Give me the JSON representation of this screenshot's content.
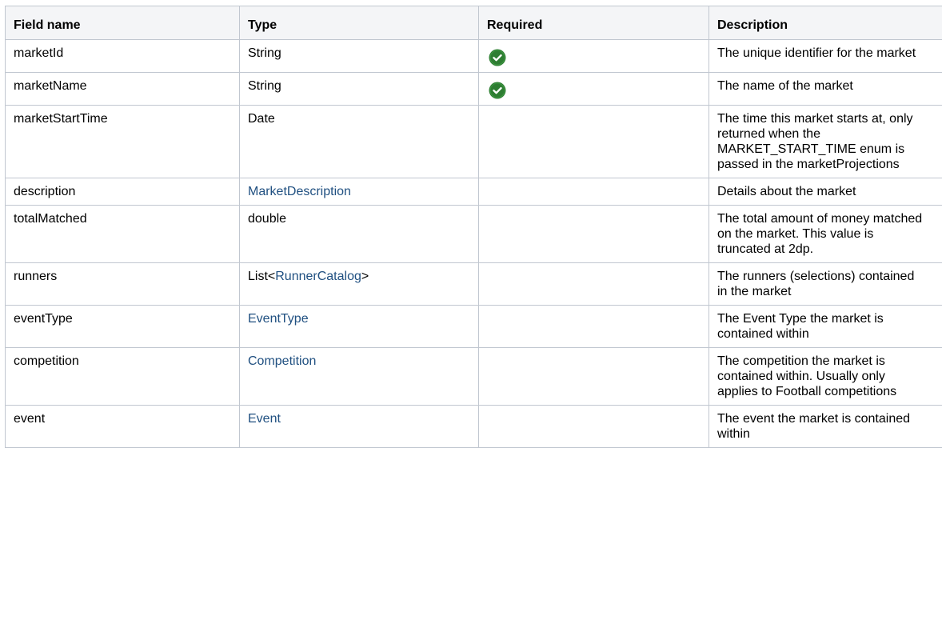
{
  "table": {
    "headers": [
      "Field name",
      "Type",
      "Required",
      "Description"
    ],
    "rows": [
      {
        "field": "marketId",
        "type_text": "String",
        "required": true,
        "description": "The unique identifier for the market"
      },
      {
        "field": "marketName",
        "type_text": "String",
        "required": true,
        "description": "The name of the market"
      },
      {
        "field": "marketStartTime",
        "type_text": "Date",
        "required": false,
        "description": "The time this market starts at, only returned when the MARKET_START_TIME enum is passed in the marketProjections"
      },
      {
        "field": "description",
        "type_link": "MarketDescription",
        "required": false,
        "description": "Details about the market"
      },
      {
        "field": "totalMatched",
        "type_text": "double",
        "required": false,
        "description": "The total amount of money matched on the market. This value is truncated at 2dp."
      },
      {
        "field": "runners",
        "type_prefix": "List<",
        "type_link": "RunnerCatalog",
        "type_suffix": ">",
        "required": false,
        "description": "The runners (selections) contained in the market"
      },
      {
        "field": "eventType",
        "type_link": "EventType",
        "required": false,
        "description": "The Event Type the market is contained within"
      },
      {
        "field": "competition",
        "type_link": "Competition",
        "required": false,
        "description": "The competition the market is contained within. Usually only applies to Football competitions"
      },
      {
        "field": "event",
        "type_link": "Event",
        "required": false,
        "description": "The event the market is contained within"
      }
    ]
  },
  "icons": {
    "required": "check-circle-icon"
  },
  "colors": {
    "link": "#205081",
    "header_bg": "#f4f5f7",
    "border": "#c1c7d0",
    "check_green": "#2e7d32"
  }
}
